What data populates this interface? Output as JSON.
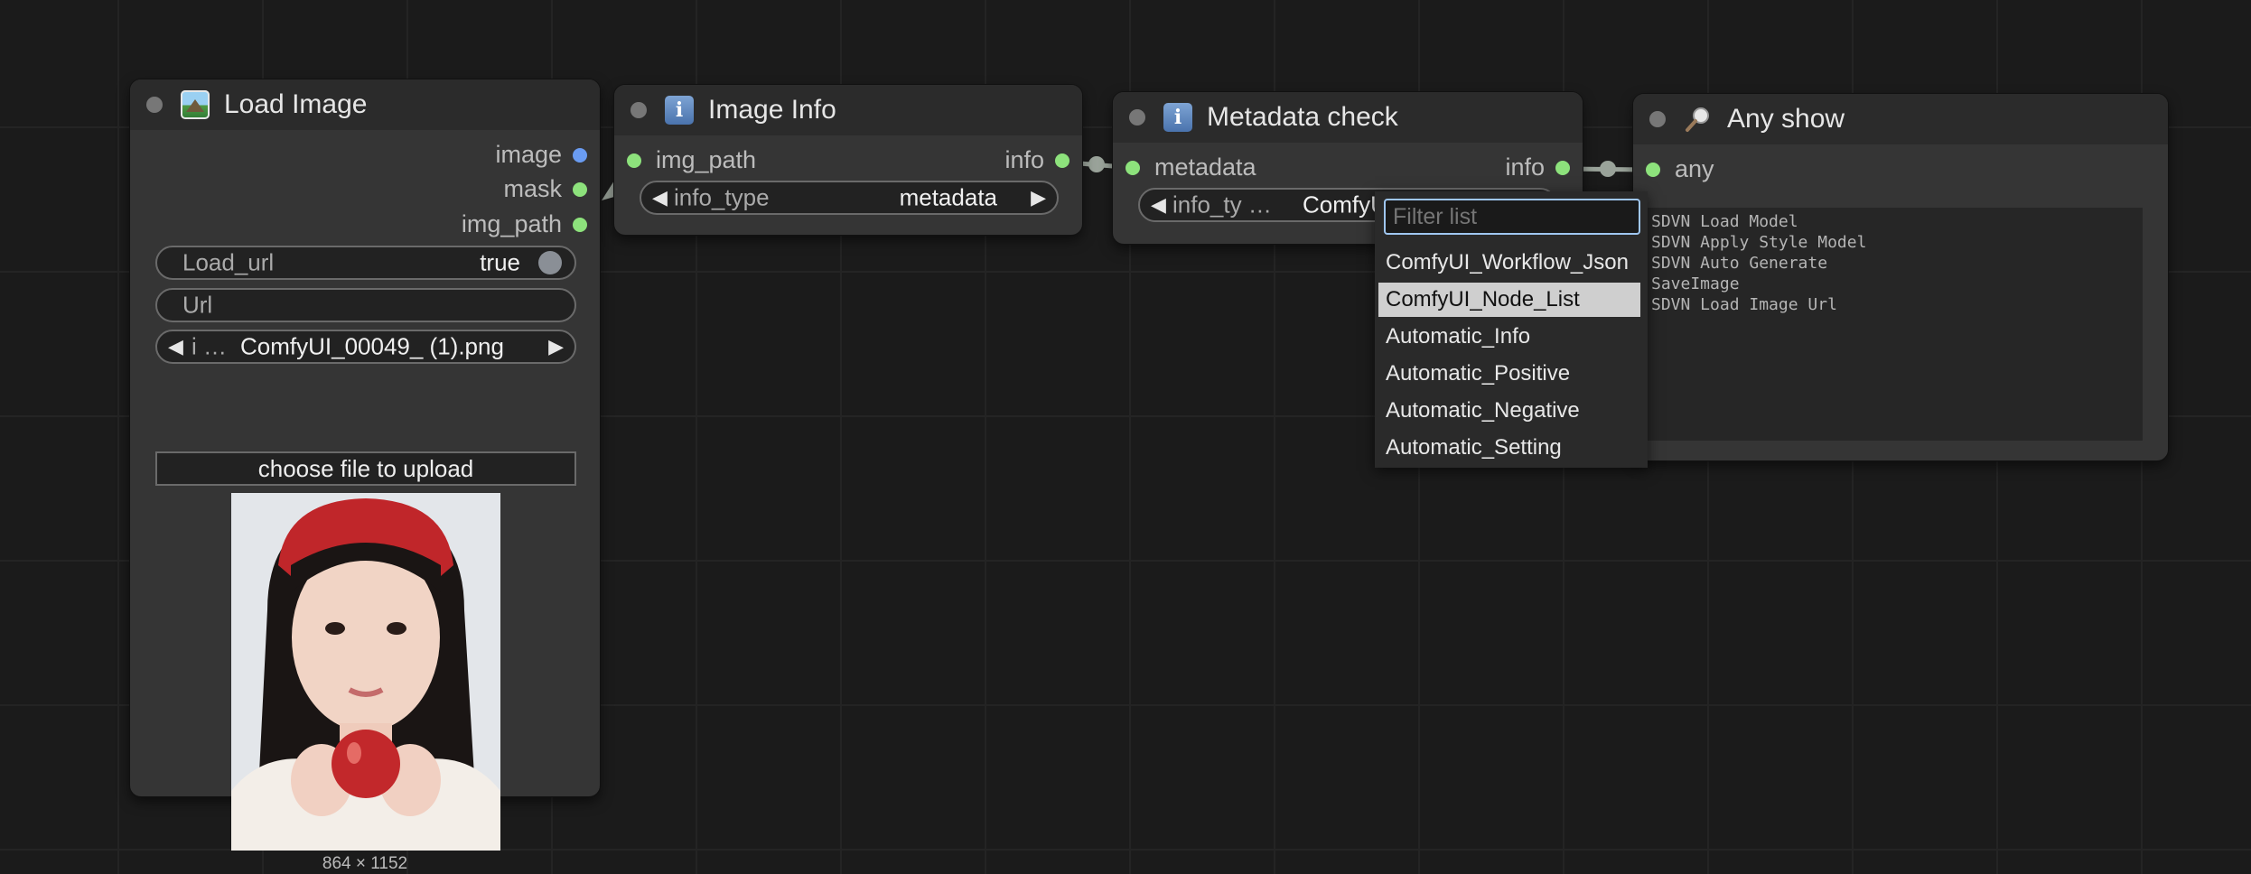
{
  "nodes": {
    "load_image": {
      "title": "Load Image",
      "outputs": [
        "image",
        "mask",
        "img_path"
      ],
      "load_url": {
        "label": "Load_url",
        "value": "true"
      },
      "url": {
        "label": "Url"
      },
      "image_select": {
        "prefix": "i …",
        "value": "ComfyUI_00049_ (1).png"
      },
      "upload_label": "choose file to upload",
      "preview_dims": "864 × 1152"
    },
    "image_info": {
      "title": "Image Info",
      "input": "img_path",
      "output": "info",
      "info_type": {
        "label": "info_type",
        "value": "metadata"
      }
    },
    "metadata_check": {
      "title": "Metadata check",
      "input": "metadata",
      "output": "info",
      "info_type": {
        "label": "info_ty …",
        "value": "ComfyUI_"
      }
    },
    "any_show": {
      "title": "Any show",
      "input": "any",
      "text_lines": [
        "SDVN Load Model",
        "SDVN Apply Style Model",
        "SDVN Auto Generate",
        "SaveImage",
        "SDVN Load Image Url"
      ]
    }
  },
  "dropdown": {
    "filter_placeholder": "Filter list",
    "items": [
      "ComfyUI_Workflow_Json",
      "ComfyUI_Node_List",
      "Automatic_Info",
      "Automatic_Positive",
      "Automatic_Negative",
      "Automatic_Setting"
    ],
    "highlighted": "ComfyUI_Node_List"
  },
  "icons": {
    "load_image": "image-icon",
    "image_info": "info-icon",
    "metadata_check": "info-icon",
    "any_show": "magnifier-icon"
  },
  "colors": {
    "canvas": "#1b1b1b",
    "node_body": "#353535",
    "node_title": "#2b2b2b",
    "slot_green": "#8de27c",
    "slot_blue": "#6a9cf2",
    "link": "#9aa39a",
    "menu_highlight": "#cfcfcf"
  }
}
